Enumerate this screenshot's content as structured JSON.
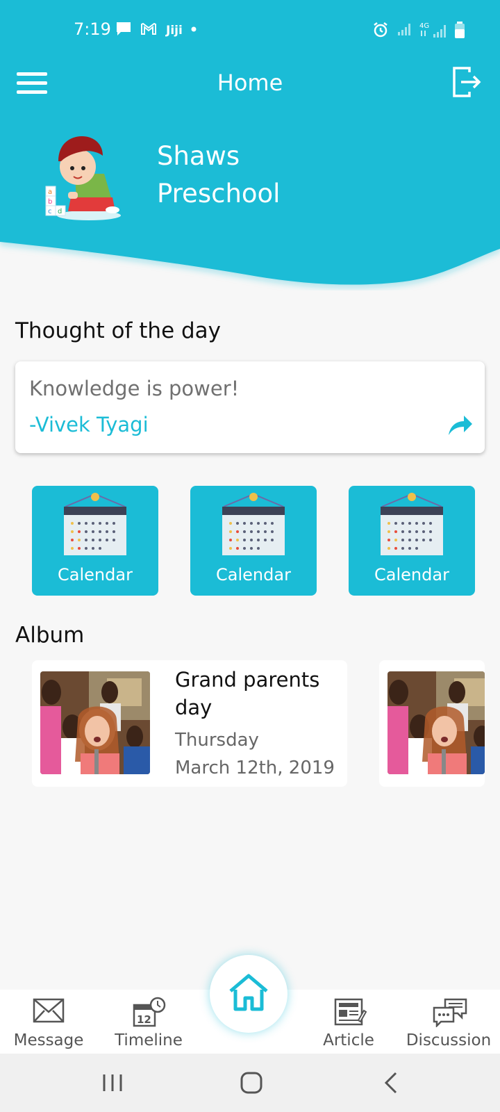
{
  "status_bar": {
    "time": "7:19"
  },
  "app_bar": {
    "title": "Home"
  },
  "school": {
    "name": "Shaws Preschool"
  },
  "thought": {
    "section_title": "Thought of the day",
    "quote": "Knowledge is power!",
    "author": "-Vivek Tyagi"
  },
  "tiles": [
    {
      "label": "Calendar",
      "icon": "calendar-icon"
    },
    {
      "label": "Calendar",
      "icon": "calendar-icon"
    },
    {
      "label": "Calendar",
      "icon": "calendar-icon"
    }
  ],
  "album": {
    "section_title": "Album",
    "items": [
      {
        "title": "Grand parents day",
        "day": "Thursday",
        "date": "March 12th, 2019"
      }
    ]
  },
  "bottom_nav": {
    "items": [
      {
        "label": "Message",
        "icon": "envelope-icon"
      },
      {
        "label": "Timeline",
        "icon": "calendar-clock-icon"
      },
      {
        "label": "Article",
        "icon": "newspaper-icon"
      },
      {
        "label": "Discussion",
        "icon": "chat-bubbles-icon"
      }
    ],
    "center": {
      "icon": "home-icon"
    }
  },
  "colors": {
    "accent": "#1bbcd6",
    "background": "#f7f7f7"
  }
}
